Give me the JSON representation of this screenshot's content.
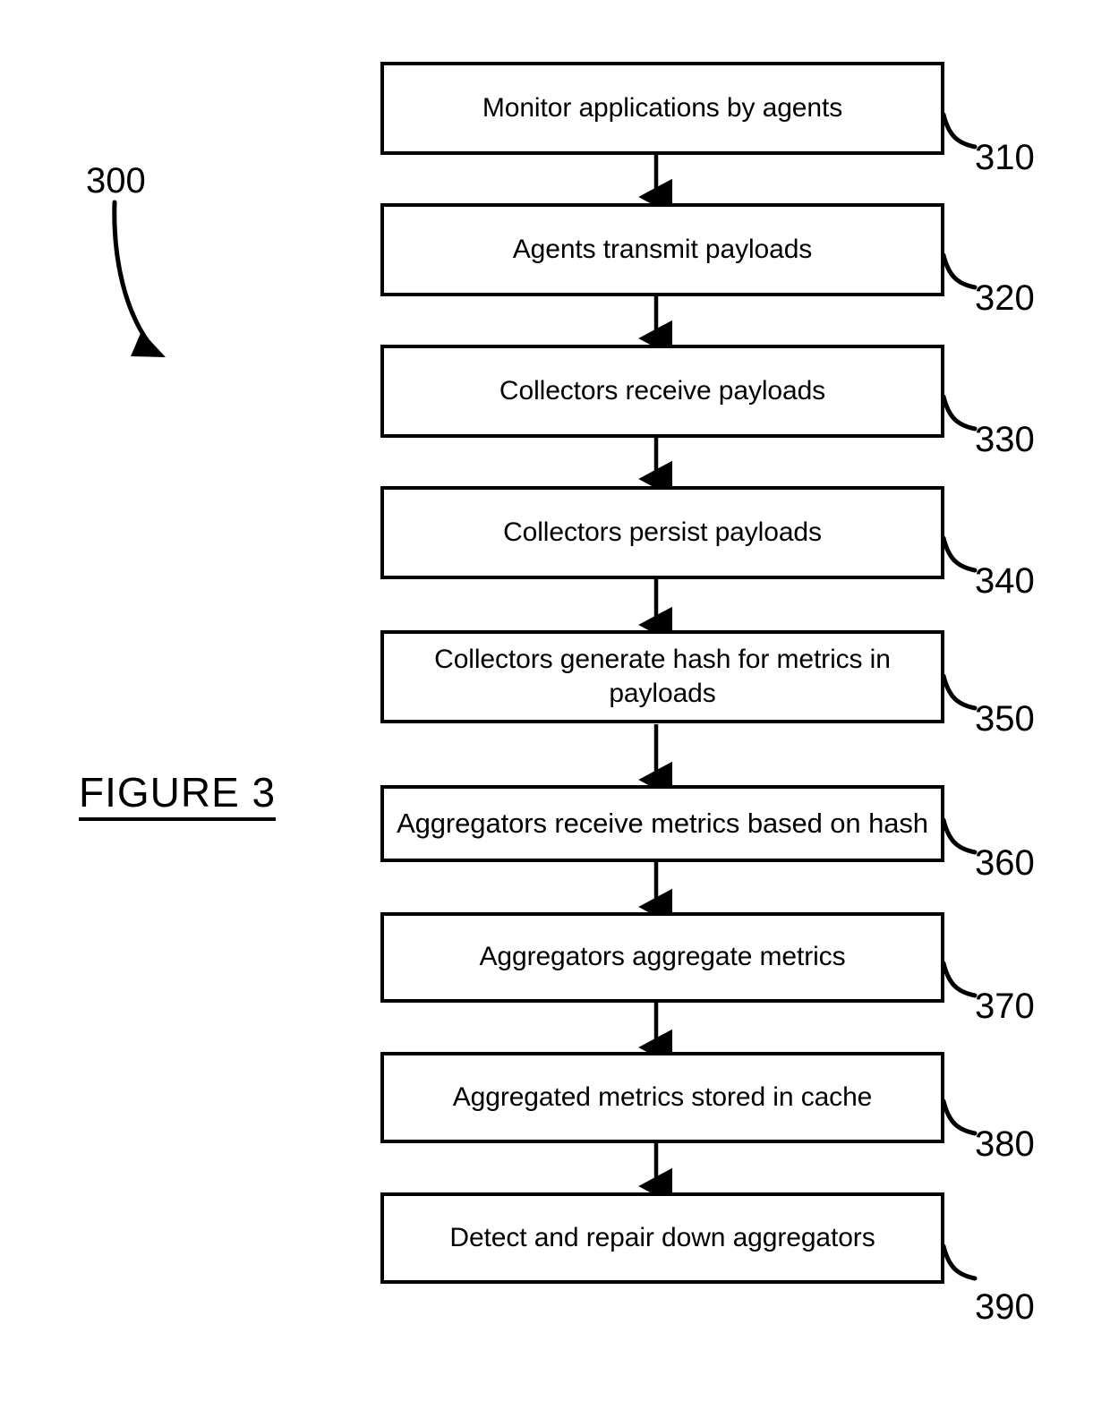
{
  "figure": {
    "caption": "FIGURE 3",
    "process_id": "300"
  },
  "flowchart": {
    "type": "vertical-process-flow",
    "orientation": "top-to-bottom",
    "steps": [
      {
        "ref": "310",
        "text": "Monitor applications by agents"
      },
      {
        "ref": "320",
        "text": "Agents transmit payloads"
      },
      {
        "ref": "330",
        "text": "Collectors receive payloads"
      },
      {
        "ref": "340",
        "text": "Collectors persist payloads"
      },
      {
        "ref": "350",
        "text": "Collectors generate hash for metrics in payloads"
      },
      {
        "ref": "360",
        "text": "Aggregators receive metrics based on hash"
      },
      {
        "ref": "370",
        "text": "Aggregators aggregate metrics"
      },
      {
        "ref": "380",
        "text": "Aggregated metrics stored in cache"
      },
      {
        "ref": "390",
        "text": "Detect and repair down aggregators"
      }
    ]
  },
  "colors": {
    "stroke": "#000000",
    "fill": "#ffffff",
    "text": "#000000"
  }
}
